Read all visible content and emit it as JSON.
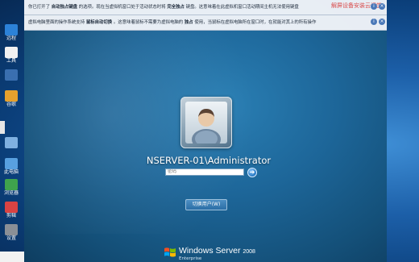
{
  "host": {
    "icons": [
      {
        "icon": "app-icon",
        "caption": "远程"
      },
      {
        "icon": "app-icon",
        "caption": "工具"
      },
      {
        "icon": "app-icon",
        "caption": ""
      },
      {
        "icon": "app-icon",
        "caption": "谷歌"
      },
      {
        "icon": "app-icon",
        "caption": ""
      },
      {
        "icon": "app-icon",
        "caption": "此电脑"
      },
      {
        "icon": "app-icon",
        "caption": "浏览器"
      },
      {
        "icon": "app-icon",
        "caption": "剪辑"
      },
      {
        "icon": "app-icon",
        "caption": "设置"
      }
    ]
  },
  "notices": [
    {
      "pre": "你已打开了",
      "bold1": "自动独占键盘",
      "mid": "的选项。现在当虚拟机窗口处于活动状态时将",
      "bold2": "完全独占",
      "post": "键盘。这意味着在此虚拟机窗口活动期间主机无法使用键盘"
    },
    {
      "pre": "虚拟电脑里面的操作系统支持",
      "bold1": "鼠标自动切换",
      "mid": "。这意味着鼠标不需要为虚拟电脑的",
      "bold2": "独占",
      "post": "使用，当鼠标在虚拟电脑所在窗口时，在就能对其上的所有操作"
    }
  ],
  "watermark": "解屏设备安装云课堂",
  "login": {
    "username": "NSERVER-01\\Administrator",
    "password_placeholder": "密码",
    "go_icon": "arrow-right-icon",
    "switch_user": "切换用户(W)"
  },
  "brand": {
    "name": "Windows Server",
    "version": "2008",
    "edition": "Enterprise"
  },
  "colors": {
    "login_bg": "#1d6699",
    "host_bg": "#1c5fa8",
    "watermark": "#d94b4b"
  }
}
